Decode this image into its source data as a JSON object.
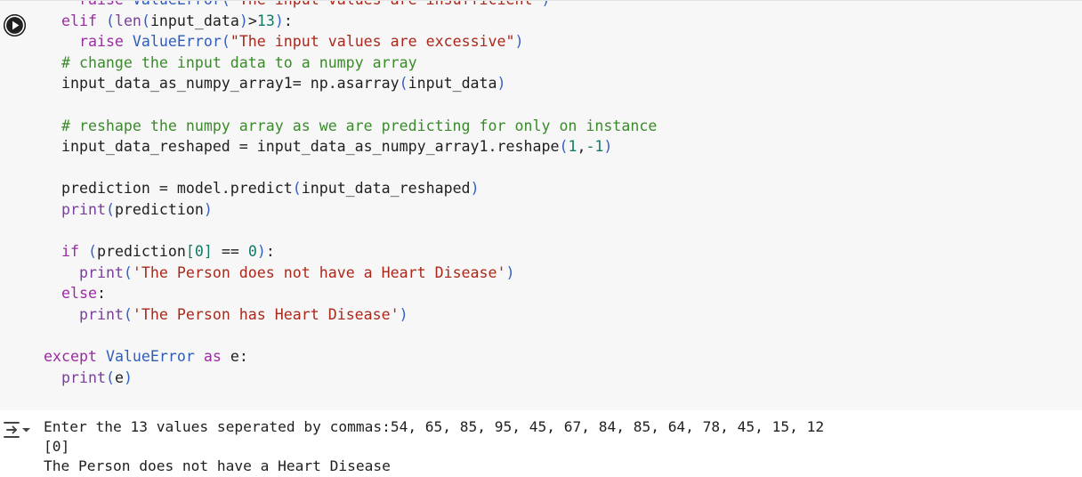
{
  "code_cell": {
    "lines": [
      [
        {
          "t": "    ",
          "c": "txt"
        },
        {
          "t": "raise",
          "c": "kw"
        },
        {
          "t": " ",
          "c": "txt"
        },
        {
          "t": "ValueError",
          "c": "cls"
        },
        {
          "t": "(",
          "c": "br"
        },
        {
          "t": "\"The input values are insufficient\"",
          "c": "str"
        },
        {
          "t": ")",
          "c": "br"
        }
      ],
      [
        {
          "t": "  ",
          "c": "txt"
        },
        {
          "t": "elif",
          "c": "kw"
        },
        {
          "t": " ",
          "c": "txt"
        },
        {
          "t": "(",
          "c": "br"
        },
        {
          "t": "len",
          "c": "bi"
        },
        {
          "t": "(",
          "c": "br"
        },
        {
          "t": "input_data",
          "c": "txt"
        },
        {
          "t": ")",
          "c": "br"
        },
        {
          "t": ">",
          "c": "txt"
        },
        {
          "t": "13",
          "c": "num"
        },
        {
          "t": ")",
          "c": "br"
        },
        {
          "t": ":",
          "c": "txt"
        }
      ],
      [
        {
          "t": "    ",
          "c": "txt"
        },
        {
          "t": "raise",
          "c": "kw"
        },
        {
          "t": " ",
          "c": "txt"
        },
        {
          "t": "ValueError",
          "c": "cls"
        },
        {
          "t": "(",
          "c": "br"
        },
        {
          "t": "\"The input values are excessive\"",
          "c": "str"
        },
        {
          "t": ")",
          "c": "br"
        }
      ],
      [
        {
          "t": "  ",
          "c": "txt"
        },
        {
          "t": "# change the input data to a numpy array",
          "c": "cm"
        }
      ],
      [
        {
          "t": "  input_data_as_numpy_array1= np.asarray",
          "c": "txt"
        },
        {
          "t": "(",
          "c": "br"
        },
        {
          "t": "input_data",
          "c": "txt"
        },
        {
          "t": ")",
          "c": "br"
        }
      ],
      [],
      [
        {
          "t": "  ",
          "c": "txt"
        },
        {
          "t": "# reshape the numpy array as we are predicting for only on instance",
          "c": "cm"
        }
      ],
      [
        {
          "t": "  input_data_reshaped = input_data_as_numpy_array1.reshape",
          "c": "txt"
        },
        {
          "t": "(",
          "c": "br"
        },
        {
          "t": "1",
          "c": "num"
        },
        {
          "t": ",",
          "c": "txt"
        },
        {
          "t": "-1",
          "c": "num"
        },
        {
          "t": ")",
          "c": "br"
        }
      ],
      [],
      [
        {
          "t": "  prediction = model.predict",
          "c": "txt"
        },
        {
          "t": "(",
          "c": "br"
        },
        {
          "t": "input_data_reshaped",
          "c": "txt"
        },
        {
          "t": ")",
          "c": "br"
        }
      ],
      [
        {
          "t": "  ",
          "c": "txt"
        },
        {
          "t": "print",
          "c": "bi"
        },
        {
          "t": "(",
          "c": "br"
        },
        {
          "t": "prediction",
          "c": "txt"
        },
        {
          "t": ")",
          "c": "br"
        }
      ],
      [],
      [
        {
          "t": "  ",
          "c": "txt"
        },
        {
          "t": "if",
          "c": "kw"
        },
        {
          "t": " ",
          "c": "txt"
        },
        {
          "t": "(",
          "c": "br"
        },
        {
          "t": "prediction",
          "c": "txt"
        },
        {
          "t": "[",
          "c": "num"
        },
        {
          "t": "0",
          "c": "num"
        },
        {
          "t": "]",
          "c": "num"
        },
        {
          "t": " == ",
          "c": "txt"
        },
        {
          "t": "0",
          "c": "num"
        },
        {
          "t": ")",
          "c": "br"
        },
        {
          "t": ":",
          "c": "txt"
        }
      ],
      [
        {
          "t": "    ",
          "c": "txt"
        },
        {
          "t": "print",
          "c": "bi"
        },
        {
          "t": "(",
          "c": "br"
        },
        {
          "t": "'The Person does not have a Heart Disease'",
          "c": "str"
        },
        {
          "t": ")",
          "c": "br"
        }
      ],
      [
        {
          "t": "  ",
          "c": "txt"
        },
        {
          "t": "else",
          "c": "kw"
        },
        {
          "t": ":",
          "c": "txt"
        }
      ],
      [
        {
          "t": "    ",
          "c": "txt"
        },
        {
          "t": "print",
          "c": "bi"
        },
        {
          "t": "(",
          "c": "br"
        },
        {
          "t": "'The Person has Heart Disease'",
          "c": "str"
        },
        {
          "t": ")",
          "c": "br"
        }
      ],
      [],
      [
        {
          "t": "except",
          "c": "kw"
        },
        {
          "t": " ",
          "c": "txt"
        },
        {
          "t": "ValueError",
          "c": "cls"
        },
        {
          "t": " ",
          "c": "txt"
        },
        {
          "t": "as",
          "c": "kw"
        },
        {
          "t": " e:",
          "c": "txt"
        }
      ],
      [
        {
          "t": "  ",
          "c": "txt"
        },
        {
          "t": "print",
          "c": "bi"
        },
        {
          "t": "(",
          "c": "br"
        },
        {
          "t": "e",
          "c": "txt"
        },
        {
          "t": ")",
          "c": "br"
        }
      ]
    ]
  },
  "run_button": {
    "icon": "play-icon"
  },
  "output": {
    "icon": "output-toggle-icon",
    "lines": [
      "Enter the 13 values seperated by commas:54, 65, 85, 95, 45, 67, 84, 85, 64, 78, 45, 15, 12",
      "[0]",
      "The Person does not have a Heart Disease"
    ]
  }
}
